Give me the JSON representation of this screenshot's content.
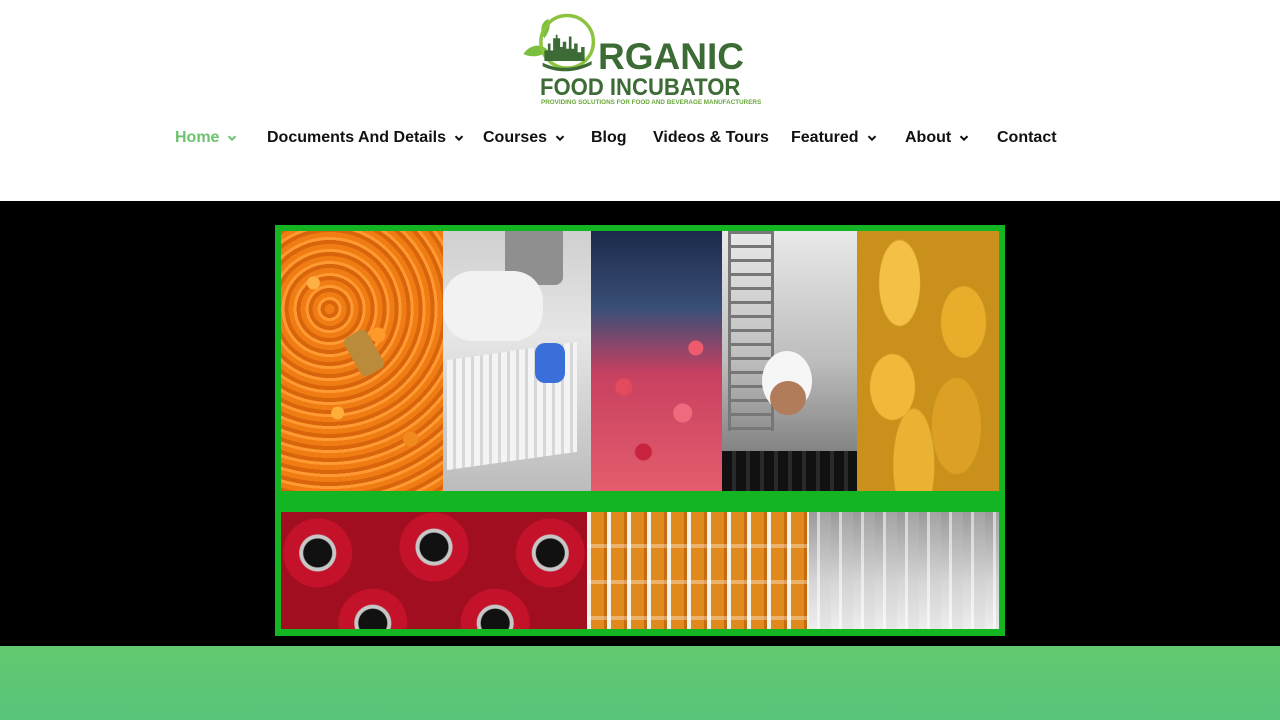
{
  "logo": {
    "line1": "RGANIC",
    "line2": "FOOD INCUBATOR",
    "tagline": "PROVIDING SOLUTIONS FOR FOOD AND BEVERAGE MANUFACTURERS",
    "alt": "Organic Food Incubator logo"
  },
  "nav": {
    "items": [
      {
        "label": "Home",
        "has_dropdown": true,
        "active": true
      },
      {
        "label": "Documents And Details",
        "has_dropdown": true,
        "active": false
      },
      {
        "label": "Courses",
        "has_dropdown": true,
        "active": false
      },
      {
        "label": "Blog",
        "has_dropdown": false,
        "active": false
      },
      {
        "label": "Videos & Tours",
        "has_dropdown": false,
        "active": false
      },
      {
        "label": "Featured",
        "has_dropdown": true,
        "active": false
      },
      {
        "label": "About",
        "has_dropdown": true,
        "active": false
      },
      {
        "label": "Contact",
        "has_dropdown": false,
        "active": false
      }
    ]
  },
  "colors": {
    "active_nav": "#6cc36e",
    "nav_text": "#111111",
    "brand_green": "#3d6b35",
    "collage_border": "#13b523",
    "hero_bg": "#000000",
    "footer_band": "#5fc873"
  }
}
